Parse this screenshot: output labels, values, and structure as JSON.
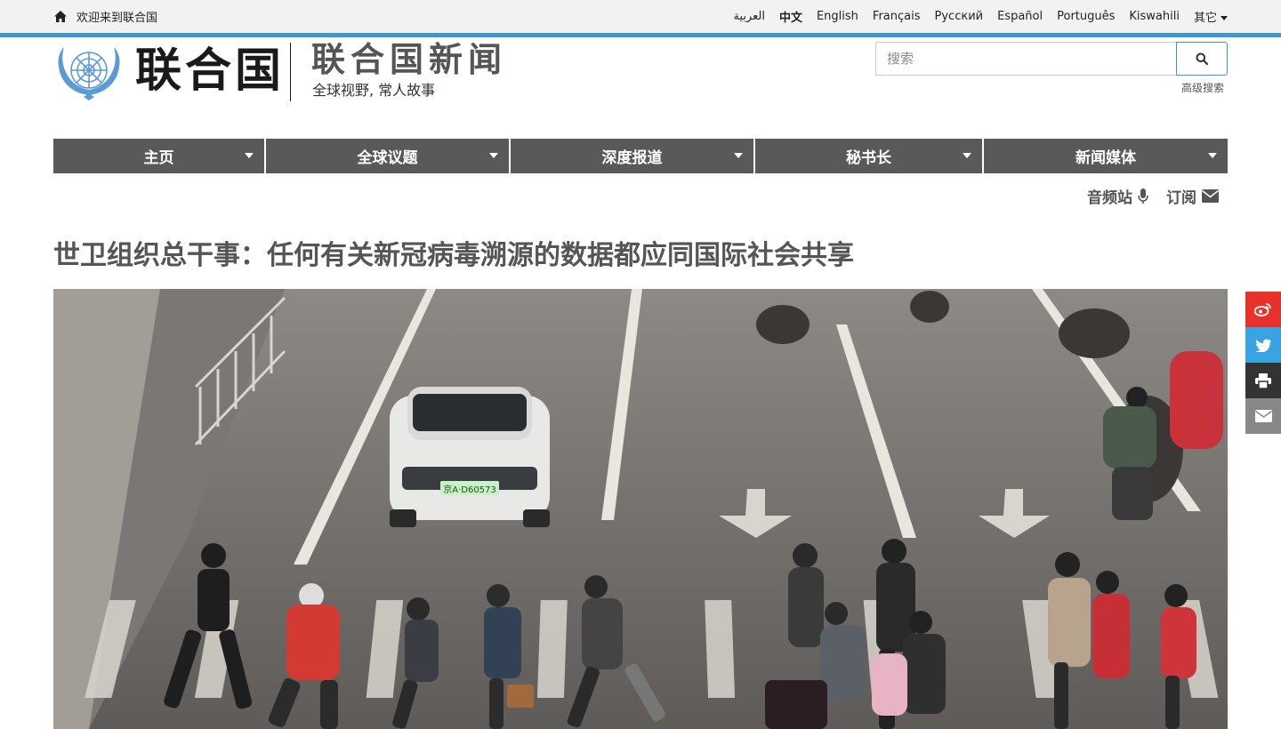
{
  "topbar": {
    "welcome": "欢迎来到联合国",
    "languages": [
      {
        "label": "العربية",
        "active": false
      },
      {
        "label": "中文",
        "active": true
      },
      {
        "label": "English",
        "active": false
      },
      {
        "label": "Français",
        "active": false
      },
      {
        "label": "Русский",
        "active": false
      },
      {
        "label": "Español",
        "active": false
      },
      {
        "label": "Português",
        "active": false
      },
      {
        "label": "Kiswahili",
        "active": false
      }
    ],
    "other": "其它"
  },
  "header": {
    "un_title": "联合国",
    "news_title": "联合国新闻",
    "tagline": "全球视野, 常人故事",
    "search_placeholder": "搜索",
    "advanced_search": "高级搜索"
  },
  "nav": {
    "items": [
      {
        "label": "主页"
      },
      {
        "label": "全球议题"
      },
      {
        "label": "深度报道"
      },
      {
        "label": "秘书长"
      },
      {
        "label": "新闻媒体"
      }
    ]
  },
  "subnav": {
    "audio": "音频站",
    "subscribe": "订阅"
  },
  "article": {
    "headline": "世卫组织总干事：任何有关新冠病毒溯源的数据都应同国际社会共享",
    "license_plate": "京A·D60573"
  },
  "share": {
    "icons": [
      "weibo-icon",
      "twitter-icon",
      "print-icon",
      "email-icon"
    ],
    "colors": {
      "weibo": "#e6322b",
      "twitter": "#3aa3e3",
      "print": "#333333",
      "email": "#888888"
    }
  },
  "colors": {
    "accent": "#3b98d3",
    "nav_bg": "#595959",
    "headline": "#555555"
  }
}
